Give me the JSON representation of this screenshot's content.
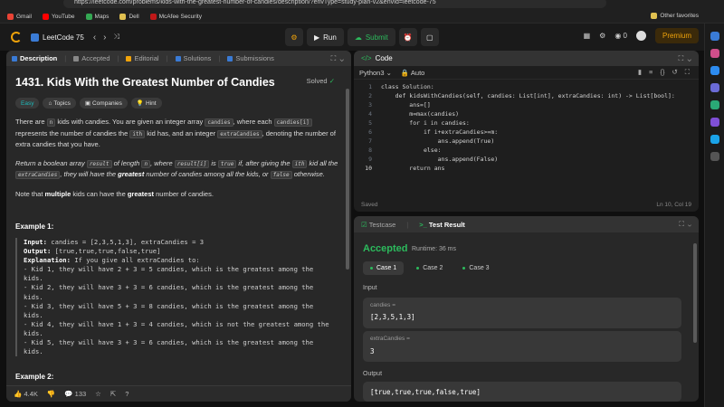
{
  "browser": {
    "url": "https://leetcode.com/problems/kids-with-the-greatest-number-of-candies/description/?envType=study-plan-v2&envId=leetcode-75",
    "bookmarks": [
      "Gmail",
      "YouTube",
      "Maps",
      "Dell",
      "McAfee Security"
    ],
    "other_favorites": "Other favorites"
  },
  "topbar": {
    "list_name": "LeetCode 75",
    "run_label": "Run",
    "submit_label": "Submit",
    "coins": "0",
    "premium_label": "Premium"
  },
  "left_tabs": [
    "Description",
    "Accepted",
    "Editorial",
    "Solutions",
    "Submissions"
  ],
  "problem": {
    "title": "1431. Kids With the Greatest Number of Candies",
    "status": "Solved",
    "chips": [
      "Easy",
      "Topics",
      "Companies",
      "Hint"
    ],
    "para1": [
      "There are ",
      "n",
      " kids with candies. You are given an integer array ",
      "candies",
      ", where each ",
      "candies[i]",
      " represents the number of candies the ",
      "ith",
      " kid has, and an integer ",
      "extraCandies",
      ", denoting the number of extra candies that you have."
    ],
    "para2": [
      "Return ",
      "a boolean array ",
      "result",
      " of length ",
      "n",
      ", where ",
      "result[i]",
      " is ",
      "true",
      " if, after giving the ",
      "ith",
      " kid all the ",
      "extraCandies",
      ", they will have the ",
      "greatest",
      " number of candies among all the kids, or ",
      "false",
      " otherwise."
    ],
    "para3_a": "Note that ",
    "para3_b": "multiple",
    "para3_c": " kids can have the ",
    "para3_d": "greatest",
    "para3_e": " number of candies.",
    "example1_title": "Example 1:",
    "example1": {
      "input_label": "Input:",
      "input": " candies = [2,3,5,1,3], extraCandies = 3",
      "output_label": "Output:",
      "output": " [true,true,true,false,true]",
      "expl_label": "Explanation:",
      "expl": " If you give all extraCandies to:",
      "lines": [
        "- Kid 1, they will have 2 + 3 = 5 candies, which is the greatest among the",
        "kids.",
        "- Kid 2, they will have 3 + 3 = 6 candies, which is the greatest among the",
        "kids.",
        "- Kid 3, they will have 5 + 3 = 8 candies, which is the greatest among the",
        "kids.",
        "- Kid 4, they will have 1 + 3 = 4 candies, which is not the greatest among the",
        "kids.",
        "- Kid 5, they will have 3 + 3 = 6 candies, which is the greatest among the",
        "kids."
      ]
    },
    "example2_title": "Example 2:",
    "likes": "4.4K",
    "comments": "133"
  },
  "code": {
    "header": "Code",
    "language": "Python3",
    "mode": "Auto",
    "lines": [
      "class Solution:",
      "    def kidsWithCandies(self, candies: List[int], extraCandies: int) -> List[bool]:",
      "        ans=[]",
      "        m=max(candies)",
      "        for i in candies:",
      "            if i+extraCandies>=m:",
      "                ans.append(True)",
      "            else:",
      "                ans.append(False)",
      "        return ans"
    ],
    "saved": "Saved",
    "position": "Ln 10, Col 19"
  },
  "result": {
    "tabs": [
      "Testcase",
      "Test Result"
    ],
    "status": "Accepted",
    "runtime": "Runtime: 36 ms",
    "cases": [
      "Case 1",
      "Case 2",
      "Case 3"
    ],
    "input_label": "Input",
    "candies_key": "candies =",
    "candies_val": "[2,3,5,1,3]",
    "extra_key": "extraCandies =",
    "extra_val": "3",
    "output_label": "Output",
    "output_val": "[true,true,true,false,true]"
  },
  "colors": {
    "accent_green": "#2cbb5d",
    "accent_orange": "#f0a30a",
    "easy": "#1cbaba"
  }
}
